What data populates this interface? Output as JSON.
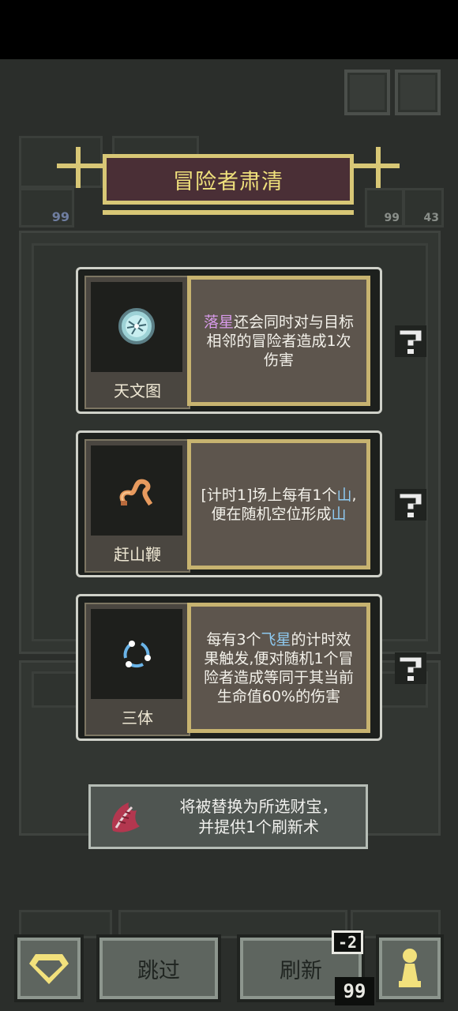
{
  "title_banner": "冒险者肃清",
  "background_counters": [
    "99",
    "99",
    "43"
  ],
  "treasures": [
    {
      "name": "天文图",
      "icon": "star-map-icon",
      "desc_parts": [
        {
          "text": "落星",
          "highlight": "purple"
        },
        {
          "text": "还会同时对与目标相邻的冒险者造成1次伤害",
          "highlight": ""
        }
      ]
    },
    {
      "name": "赶山鞭",
      "icon": "whip-icon",
      "desc_parts": [
        {
          "text": "[计时1]场上每有1个",
          "highlight": ""
        },
        {
          "text": "山",
          "highlight": "blue"
        },
        {
          "text": ",便在随机空位形成",
          "highlight": ""
        },
        {
          "text": "山",
          "highlight": "blue"
        }
      ]
    },
    {
      "name": "三体",
      "icon": "three-body-icon",
      "desc_parts": [
        {
          "text": "每有3个",
          "highlight": ""
        },
        {
          "text": "飞星",
          "highlight": "blue"
        },
        {
          "text": "的计时效果触发,便对随机1个冒险者造成等同于其当前生命值60%的伤害",
          "highlight": ""
        }
      ]
    }
  ],
  "toast": {
    "line1": "将被替换为所选财宝，",
    "line2": "并提供1个刷新术"
  },
  "bottom": {
    "skip_label": "跳过",
    "refresh_label": "刷新",
    "refresh_cost": "-2",
    "refresh_balance": "99"
  },
  "colors": {
    "accent_gold": "#d8c776",
    "highlight_purple": "#d79ae9",
    "highlight_blue": "#8ec9f0",
    "gem_yellow": "#f2e17c"
  }
}
